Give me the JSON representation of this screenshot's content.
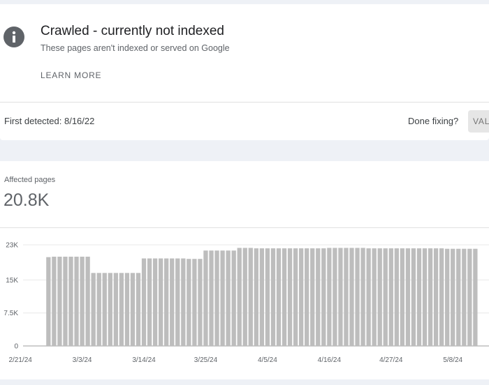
{
  "issue": {
    "icon": "info-icon",
    "title": "Crawled - currently not indexed",
    "subtitle": "These pages aren't indexed or served on Google",
    "learn_more": "LEARN MORE",
    "first_detected": "First detected: 8/16/22",
    "done_fixing": "Done fixing?",
    "validate_label": "VALIDATE FIX"
  },
  "metric": {
    "label": "Affected pages",
    "value": "20.8K"
  },
  "colors": {
    "bar": "#bdbdbd",
    "background": "#eef1f6",
    "card": "#ffffff"
  },
  "chart_data": {
    "type": "bar",
    "ylim": [
      0,
      23000
    ],
    "yticks": [
      {
        "value": 0,
        "label": "0"
      },
      {
        "value": 7500,
        "label": "7.5K"
      },
      {
        "value": 15000,
        "label": "15K"
      },
      {
        "value": 23000,
        "label": "23K"
      }
    ],
    "x": [
      "2/21/24",
      "2/22/24",
      "2/23/24",
      "2/24/24",
      "2/25/24",
      "2/26/24",
      "2/27/24",
      "2/28/24",
      "2/29/24",
      "3/1/24",
      "3/2/24",
      "3/3/24",
      "3/4/24",
      "3/5/24",
      "3/6/24",
      "3/7/24",
      "3/8/24",
      "3/9/24",
      "3/10/24",
      "3/11/24",
      "3/12/24",
      "3/13/24",
      "3/14/24",
      "3/15/24",
      "3/16/24",
      "3/17/24",
      "3/18/24",
      "3/19/24",
      "3/20/24",
      "3/21/24",
      "3/22/24",
      "3/23/24",
      "3/24/24",
      "3/25/24",
      "3/26/24",
      "3/27/24",
      "3/28/24",
      "3/29/24",
      "3/30/24",
      "3/31/24",
      "4/1/24",
      "4/2/24",
      "4/3/24",
      "4/4/24",
      "4/5/24",
      "4/6/24",
      "4/7/24",
      "4/8/24",
      "4/9/24",
      "4/10/24",
      "4/11/24",
      "4/12/24",
      "4/13/24",
      "4/14/24",
      "4/15/24",
      "4/16/24",
      "4/17/24",
      "4/18/24",
      "4/19/24",
      "4/20/24",
      "4/21/24",
      "4/22/24",
      "4/23/24",
      "4/24/24",
      "4/25/24",
      "4/26/24",
      "4/27/24",
      "4/28/24",
      "4/29/24",
      "4/30/24",
      "5/1/24",
      "5/2/24",
      "5/3/24",
      "5/4/24",
      "5/5/24",
      "5/6/24",
      "5/7/24",
      "5/8/24",
      "5/9/24",
      "5/10/24",
      "5/11/24",
      "5/12/24"
    ],
    "values": [
      null,
      null,
      null,
      null,
      null,
      20200,
      20300,
      20300,
      20300,
      20300,
      20300,
      20300,
      20300,
      16600,
      16600,
      16600,
      16600,
      16600,
      16600,
      16600,
      16600,
      16600,
      19900,
      19900,
      19900,
      19900,
      19900,
      19900,
      19900,
      19900,
      19800,
      19800,
      19800,
      21700,
      21700,
      21700,
      21700,
      21700,
      21700,
      22300,
      22300,
      22300,
      22200,
      22200,
      22200,
      22200,
      22200,
      22200,
      22200,
      22200,
      22200,
      22200,
      22200,
      22200,
      22200,
      22300,
      22300,
      22300,
      22300,
      22300,
      22300,
      22300,
      22200,
      22200,
      22200,
      22200,
      22200,
      22200,
      22200,
      22200,
      22200,
      22200,
      22200,
      22200,
      22200,
      22200,
      22100,
      22100,
      22100,
      22100,
      22100,
      22100
    ],
    "xtick_labels": [
      "2/21/24",
      "3/3/24",
      "3/14/24",
      "3/25/24",
      "4/5/24",
      "4/16/24",
      "4/27/24",
      "5/8/24"
    ],
    "grid": true,
    "legend": "none"
  }
}
